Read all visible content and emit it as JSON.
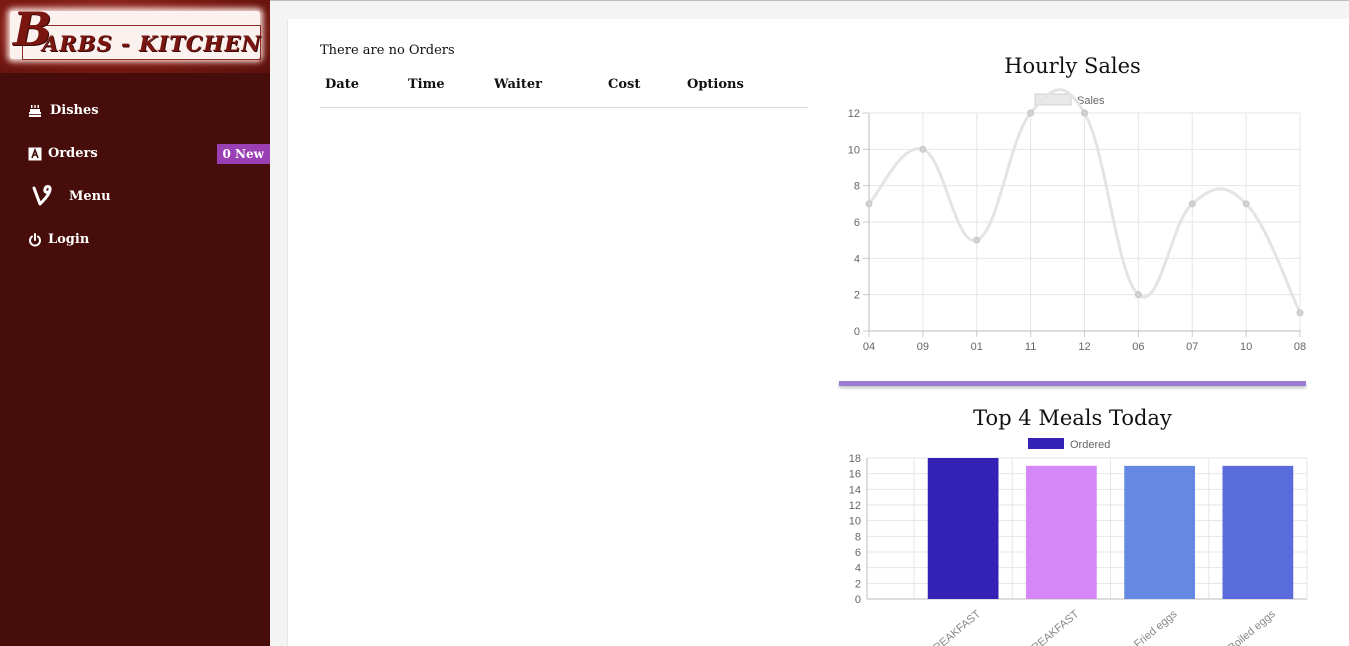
{
  "brand": {
    "initial": "B",
    "rest": "ARBS - KITCHEN"
  },
  "sidebar": {
    "items": [
      {
        "label": "Dishes",
        "icon": "cake-icon"
      },
      {
        "label": "Orders",
        "icon": "a-box-icon",
        "badge": "0 New"
      },
      {
        "label": "Menu",
        "icon": "vine-icon"
      },
      {
        "label": "Login",
        "icon": "power-icon"
      }
    ]
  },
  "orders": {
    "empty_message": "There are no Orders",
    "columns": [
      "Date",
      "Time",
      "Waiter",
      "Cost",
      "Options"
    ]
  },
  "colors": {
    "sidebar": "#470d0a",
    "badge": "#9b3fb5",
    "divider": "#9c7bd6"
  },
  "chart_data": [
    {
      "type": "line",
      "title": "Hourly Sales",
      "x": [
        "04",
        "09",
        "01",
        "11",
        "12",
        "06",
        "07",
        "10",
        "08"
      ],
      "series": [
        {
          "name": "Sales",
          "values": [
            7,
            10,
            5,
            12,
            12,
            2,
            7,
            7,
            1
          ]
        }
      ],
      "ylim": [
        0,
        12
      ],
      "yticks": [
        0,
        2,
        4,
        6,
        8,
        10,
        12
      ],
      "grid": true,
      "legend": "top-center"
    },
    {
      "type": "bar",
      "title": "Top 4 Meals Today",
      "categories": [
        "BREAKFAST",
        "BREAKFAST",
        "Fried eggs",
        "Boiled eggs"
      ],
      "series": [
        {
          "name": "Ordered",
          "values": [
            18,
            17,
            17,
            17
          ]
        }
      ],
      "bar_colors": [
        "#3322b5",
        "#d687f7",
        "#6589e3",
        "#5a6bdc"
      ],
      "ylim": [
        0,
        18
      ],
      "yticks": [
        0,
        2,
        4,
        6,
        8,
        10,
        12,
        14,
        16,
        18
      ],
      "grid": true,
      "legend": "top-center"
    }
  ]
}
